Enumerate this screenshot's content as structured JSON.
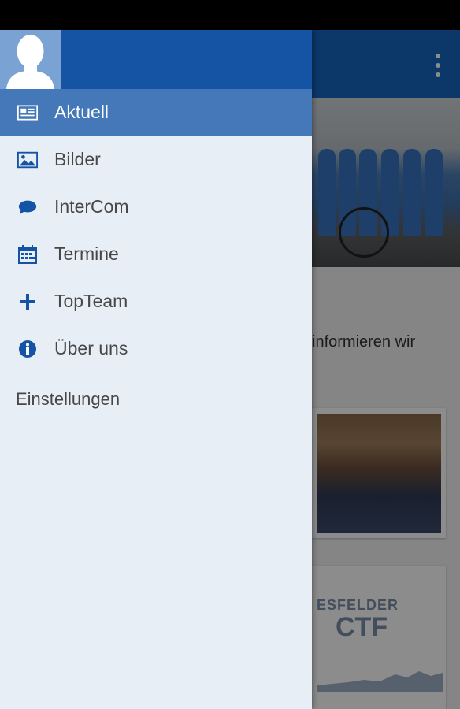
{
  "article": {
    "snippet": "informieren wir",
    "ctf_logo_line1": "ESFELDER",
    "ctf_logo_line2": "CTF"
  },
  "drawer": {
    "items": [
      {
        "label": "Aktuell",
        "icon": "newspaper-icon",
        "active": true
      },
      {
        "label": "Bilder",
        "icon": "image-icon",
        "active": false
      },
      {
        "label": "InterCom",
        "icon": "chat-bubble-icon",
        "active": false
      },
      {
        "label": "Termine",
        "icon": "calendar-icon",
        "active": false
      },
      {
        "label": "TopTeam",
        "icon": "plus-icon",
        "active": false
      },
      {
        "label": "Über uns",
        "icon": "info-icon",
        "active": false
      }
    ],
    "settings_label": "Einstellungen"
  },
  "colors": {
    "header": "#1553a4",
    "active_item": "#4478b8",
    "drawer_bg": "#e8eef5",
    "icon": "#1553a4",
    "app_bar": "#1565c0"
  }
}
